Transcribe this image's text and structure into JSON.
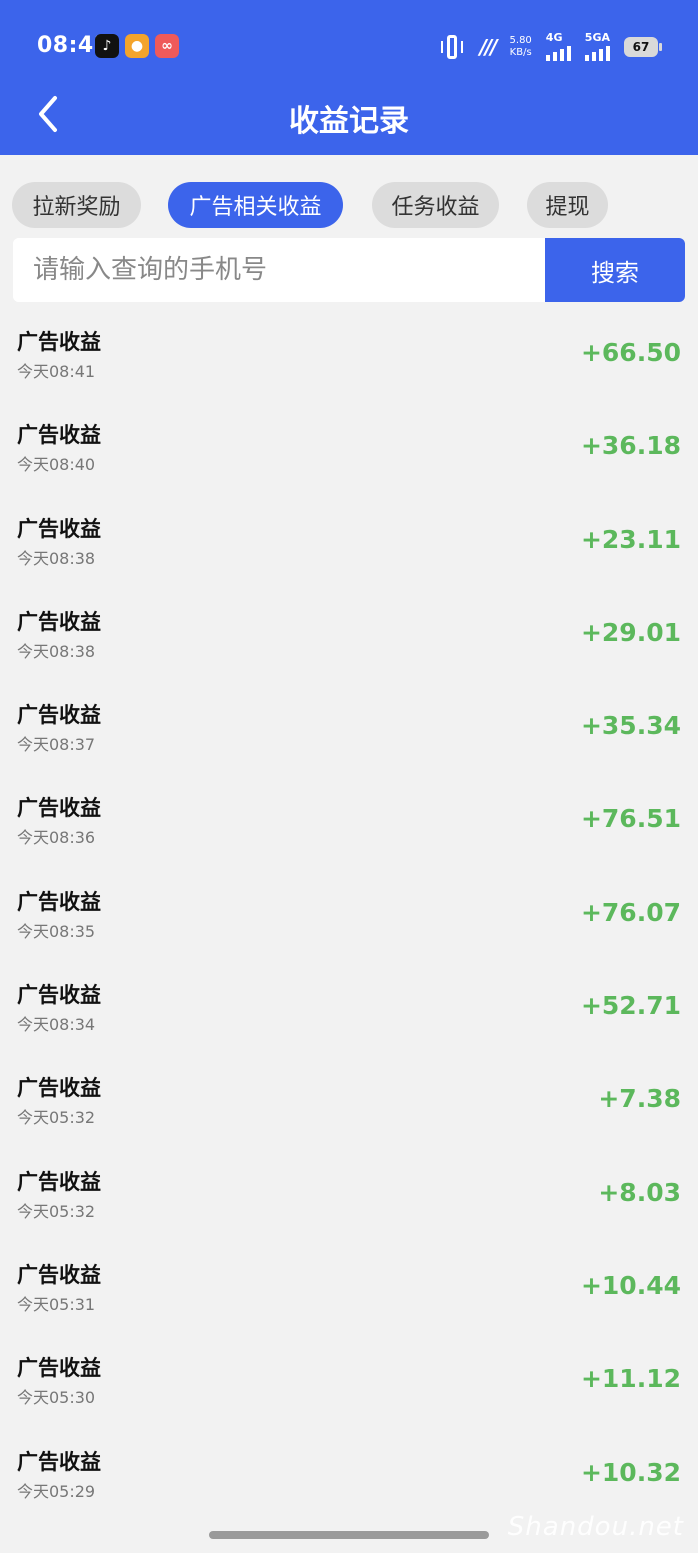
{
  "status_bar": {
    "time": "08:43",
    "app_icons": [
      "tiktok-icon",
      "map-pin-icon",
      "group-icon"
    ],
    "speed_value": "5.80",
    "speed_unit": "KB/s",
    "net1": "4G",
    "net2": "5GA",
    "battery": "67"
  },
  "nav": {
    "title": "收益记录"
  },
  "tabs": [
    {
      "label": "拉新奖励",
      "active": false
    },
    {
      "label": "广告相关收益",
      "active": true
    },
    {
      "label": "任务收益",
      "active": false
    },
    {
      "label": "提现",
      "active": false
    }
  ],
  "search": {
    "placeholder": "请输入查询的手机号",
    "button": "搜索"
  },
  "records": [
    {
      "title": "广告收益",
      "time": "今天08:41",
      "amount": "+66.50"
    },
    {
      "title": "广告收益",
      "time": "今天08:40",
      "amount": "+36.18"
    },
    {
      "title": "广告收益",
      "time": "今天08:38",
      "amount": "+23.11"
    },
    {
      "title": "广告收益",
      "time": "今天08:38",
      "amount": "+29.01"
    },
    {
      "title": "广告收益",
      "time": "今天08:37",
      "amount": "+35.34"
    },
    {
      "title": "广告收益",
      "time": "今天08:36",
      "amount": "+76.51"
    },
    {
      "title": "广告收益",
      "time": "今天08:35",
      "amount": "+76.07"
    },
    {
      "title": "广告收益",
      "time": "今天08:34",
      "amount": "+52.71"
    },
    {
      "title": "广告收益",
      "time": "今天05:32",
      "amount": "+7.38"
    },
    {
      "title": "广告收益",
      "time": "今天05:32",
      "amount": "+8.03"
    },
    {
      "title": "广告收益",
      "time": "今天05:31",
      "amount": "+10.44"
    },
    {
      "title": "广告收益",
      "time": "今天05:30",
      "amount": "+11.12"
    },
    {
      "title": "广告收益",
      "time": "今天05:29",
      "amount": "+10.32"
    }
  ],
  "watermark": "Shandou.net",
  "colors": {
    "primary": "#3c64eb",
    "amount": "#5cb85c",
    "background": "#f2f2f2"
  }
}
